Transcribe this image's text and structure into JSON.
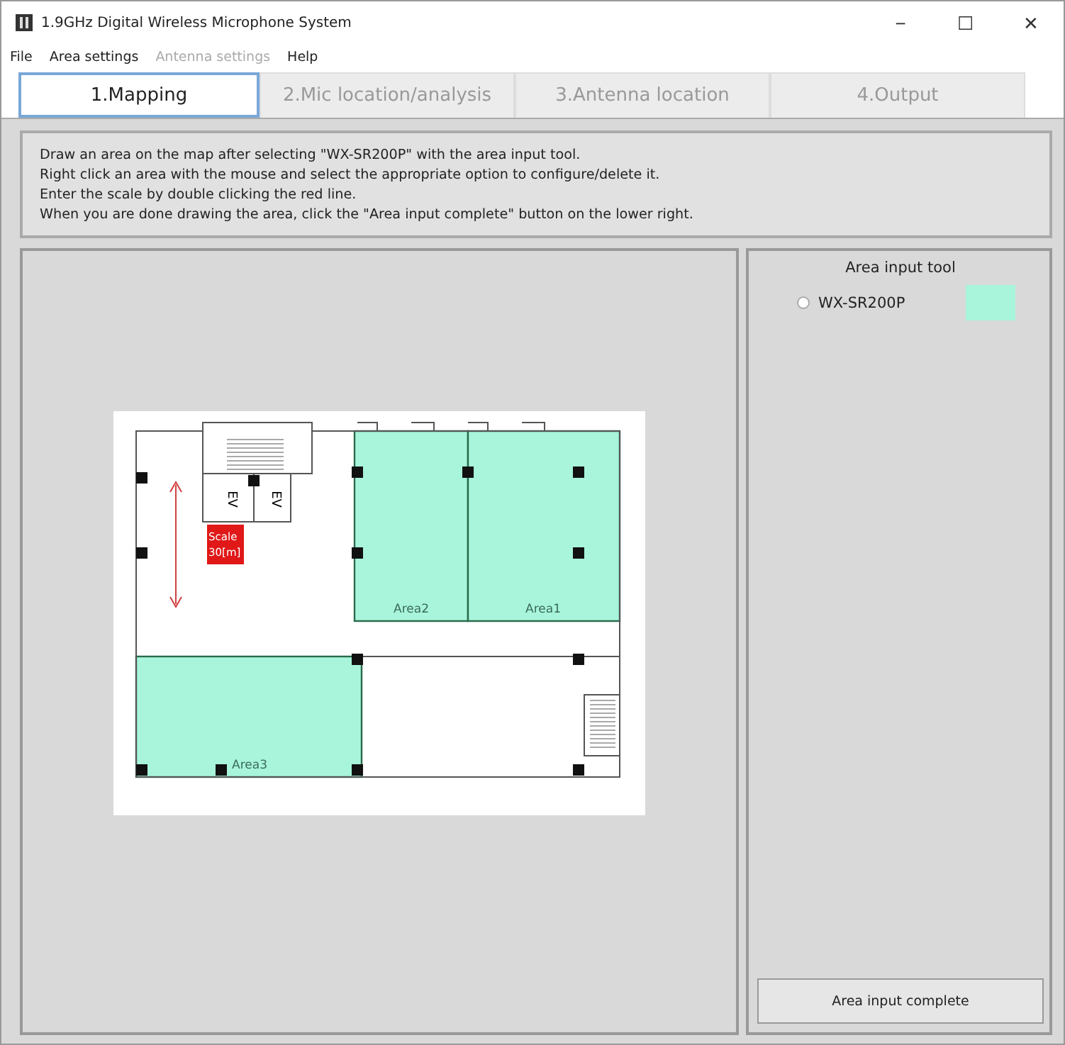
{
  "window": {
    "title": "1.9GHz Digital Wireless Microphone System",
    "controls": [
      "−",
      "☐",
      "✕"
    ]
  },
  "menu": [
    {
      "label": "File",
      "disabled": false
    },
    {
      "label": "Area settings",
      "disabled": false
    },
    {
      "label": "Antenna settings",
      "disabled": true
    },
    {
      "label": "Help",
      "disabled": false
    }
  ],
  "tabs": [
    {
      "label": "1.Mapping",
      "selected": true
    },
    {
      "label": "2.Mic location/analysis",
      "selected": false
    },
    {
      "label": "3.Antenna location",
      "selected": false
    },
    {
      "label": "4.Output",
      "selected": false
    }
  ],
  "instructions": [
    "Draw an area on the map after selecting \"WX-SR200P\" with the area input tool.",
    "Right click an area with the mouse and select the appropriate option to configure/delete it.",
    "Enter the scale by double clicking the red line.",
    "When you are done drawing the area, click the \"Area input complete\" button on the lower right."
  ],
  "map": {
    "elevator_labels": [
      "EV",
      "EV"
    ],
    "scale_label": [
      "Scale",
      "30[m]"
    ],
    "areas": [
      {
        "name": "Area2",
        "color": "#a8f5dc"
      },
      {
        "name": "Area1",
        "color": "#a8f5dc"
      },
      {
        "name": "Area3",
        "color": "#a8f5dc"
      }
    ]
  },
  "tool_panel": {
    "title": "Area input tool",
    "tools": [
      {
        "label": "WX-SR200P",
        "selected": false,
        "color": "#a8f5dc"
      }
    ],
    "button": "Area input complete"
  }
}
